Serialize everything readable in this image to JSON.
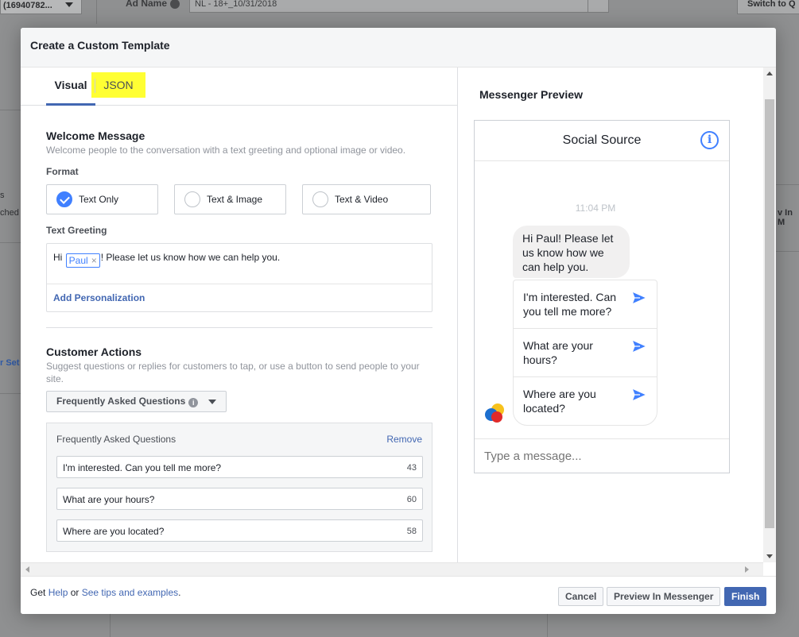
{
  "background": {
    "account_select": "(16940782...",
    "ad_name_label": "Ad Name",
    "ad_name_value": "NL - 18+_10/31/2018",
    "switch_button": "Switch to Q",
    "left_text1": "s",
    "left_text2": "ched",
    "left_text3": "r Set",
    "right_text": "v In M"
  },
  "modal": {
    "title": "Create a Custom Template",
    "tabs": {
      "visual": "Visual",
      "json": "JSON"
    },
    "welcome": {
      "heading": "Welcome Message",
      "description": "Welcome people to the conversation with a text greeting and optional image or video.",
      "format_label": "Format",
      "formats": [
        {
          "label": "Text Only",
          "selected": true
        },
        {
          "label": "Text & Image",
          "selected": false
        },
        {
          "label": "Text & Video",
          "selected": false
        }
      ],
      "text_greeting_label": "Text Greeting",
      "greeting_prefix": "Hi ",
      "greeting_token": "Paul",
      "greeting_token_remove": "×",
      "greeting_suffix": "! Please let us know how we can help you.",
      "add_personalization": "Add Personalization"
    },
    "customer_actions": {
      "heading": "Customer Actions",
      "description": "Suggest questions or replies for customers to tap, or use a button to send people to your site.",
      "dropdown_value": "Frequently Asked Questions",
      "panel_title": "Frequently Asked Questions",
      "remove": "Remove",
      "questions": [
        {
          "text": "I'm interested. Can you tell me more?",
          "count": "43"
        },
        {
          "text": "What are your hours?",
          "count": "60"
        },
        {
          "text": "Where are you located?",
          "count": "58"
        }
      ]
    },
    "preview": {
      "title": "Messenger Preview",
      "page_name": "Social Source",
      "info_glyph": "i",
      "time": "11:04 PM",
      "greeting_bubble": "Hi Paul! Please let us know how we can help you.",
      "quick_replies": [
        "I'm interested. Can you tell me more?",
        "What are your hours?",
        "Where are you located?"
      ],
      "composer_placeholder": "Type a message..."
    },
    "footer": {
      "get": "Get ",
      "help": "Help",
      "or": " or ",
      "tips": "See tips and examples",
      "period": ".",
      "cancel": "Cancel",
      "preview": "Preview In Messenger",
      "finish": "Finish"
    }
  },
  "colors": {
    "accent": "#4267b2",
    "messenger_blue": "#4080ff",
    "highlight": "#ffff33"
  },
  "icons": {
    "checkmark": "check-icon",
    "info": "info-icon",
    "send": "send-arrow-icon",
    "caret": "caret-down-icon"
  }
}
